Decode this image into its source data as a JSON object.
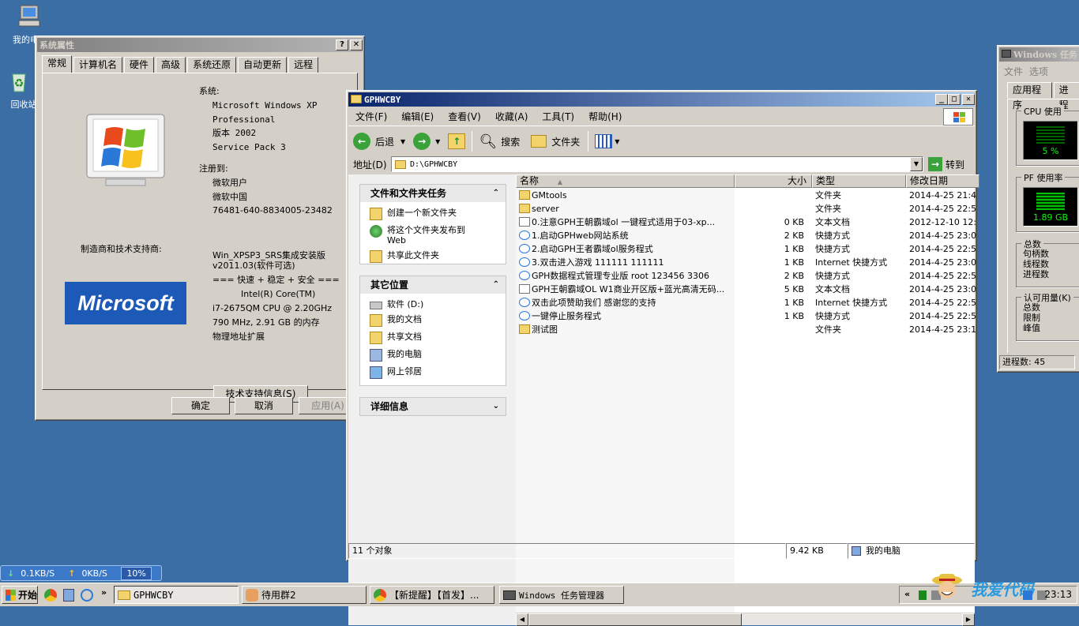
{
  "desktop": {
    "icons": [
      {
        "label": "我的电脑"
      },
      {
        "label": "回收站"
      }
    ]
  },
  "sysprop": {
    "title": "系统属性",
    "help": "?",
    "close": "✕",
    "tabs": [
      "常规",
      "计算机名",
      "硬件",
      "高级",
      "系统还原",
      "自动更新",
      "远程"
    ],
    "system_label": "系统:",
    "system_lines": [
      "Microsoft Windows XP",
      "Professional",
      "版本 2002",
      "Service Pack 3"
    ],
    "registered_label": "注册到:",
    "registered_lines": [
      "微软用户",
      "微软中国",
      "76481-640-8834005-23482"
    ],
    "manufacturer_label": "制造商和技术支持商:",
    "oem_lines": [
      "Win_XPSP3_SRS集成安装版",
      "v2011.03(软件可选)",
      "=== 快速 + 稳定 + 安全 ===",
      "Intel(R) Core(TM)",
      "i7-2675QM CPU @ 2.20GHz",
      "790 MHz, 2.91 GB 的内存",
      "物理地址扩展"
    ],
    "ms_logo": "Microsoft",
    "support_btn": "技术支持信息(S)",
    "ok": "确定",
    "cancel": "取消",
    "apply": "应用(A)"
  },
  "explorer": {
    "title": "GPHWCBY",
    "menu": [
      "文件(F)",
      "编辑(E)",
      "查看(V)",
      "收藏(A)",
      "工具(T)",
      "帮助(H)"
    ],
    "back": "后退",
    "search": "搜索",
    "folders": "文件夹",
    "address_label": "地址(D)",
    "address_value": "D:\\GPHWCBY",
    "go": "转到",
    "tasks_header": "文件和文件夹任务",
    "tasks": [
      "创建一个新文件夹",
      "将这个文件夹发布到 Web",
      "共享此文件夹"
    ],
    "places_header": "其它位置",
    "places": [
      "软件 (D:)",
      "我的文档",
      "共享文档",
      "我的电脑",
      "网上邻居"
    ],
    "details_header": "详细信息",
    "columns": {
      "name": "名称",
      "size": "大小",
      "type": "类型",
      "modified": "修改日期"
    },
    "files": [
      {
        "name": "GMtools",
        "size": "",
        "type": "文件夹",
        "date": "2014-4-25 21:4"
      },
      {
        "name": "server",
        "size": "",
        "type": "文件夹",
        "date": "2014-4-25 22:5"
      },
      {
        "name": "0.注意GPH王朝霸域ol 一键程式适用于03-xp...",
        "size": "0 KB",
        "type": "文本文档",
        "date": "2012-12-10 12:"
      },
      {
        "name": "1.启动GPHweb网站系统",
        "size": "2 KB",
        "type": "快捷方式",
        "date": "2014-4-25 23:0"
      },
      {
        "name": "2.启动GPH王者霸域ol服务程式",
        "size": "1 KB",
        "type": "快捷方式",
        "date": "2014-4-25 22:5"
      },
      {
        "name": "3.双击进入游戏 111111 111111",
        "size": "1 KB",
        "type": "Internet 快捷方式",
        "date": "2014-4-25 23:0"
      },
      {
        "name": "GPH数据程式管理专业版 root 123456 3306",
        "size": "2 KB",
        "type": "快捷方式",
        "date": "2014-4-25 22:5"
      },
      {
        "name": "GPH王朝霸域OL W1商业开区版+蓝光高清无码...",
        "size": "5 KB",
        "type": "文本文档",
        "date": "2014-4-25 23:0"
      },
      {
        "name": "双击此项赞助我们 感谢您的支持",
        "size": "1 KB",
        "type": "Internet 快捷方式",
        "date": "2014-4-25 22:5"
      },
      {
        "name": "一键停止服务程式",
        "size": "1 KB",
        "type": "快捷方式",
        "date": "2014-4-25 22:5"
      },
      {
        "name": "测试图",
        "size": "",
        "type": "文件夹",
        "date": "2014-4-25 23:1"
      }
    ],
    "status_count": "11 个对象",
    "status_size": "9.42 KB",
    "status_location": "我的电脑"
  },
  "taskmgr": {
    "title": "Windows 任务",
    "menu": [
      "文件",
      "选项"
    ],
    "tabs": [
      "应用程序",
      "进程"
    ],
    "cpu_label": "CPU 使用",
    "cpu_value": "5 %",
    "pf_label": "PF 使用率",
    "pf_value": "1.89 GB",
    "totals_label": "总数",
    "totals_items": [
      "句柄数",
      "线程数",
      "进程数"
    ],
    "commit_label": "认可用量(K)",
    "commit_items": [
      "总数",
      "限制",
      "峰值"
    ],
    "status": "进程数: 45"
  },
  "netmeter": {
    "down": "0.1KB/S",
    "up": "0KB/S",
    "pct": "10%"
  },
  "taskbar": {
    "start": "开始",
    "tasks": [
      "GPHWCBY",
      "待用群2",
      "【新提醒】【首发】...",
      "Windows 任务管理器"
    ],
    "more": "»",
    "tray_more": "«",
    "clock": "23:13",
    "watermark": "我爱代码"
  }
}
